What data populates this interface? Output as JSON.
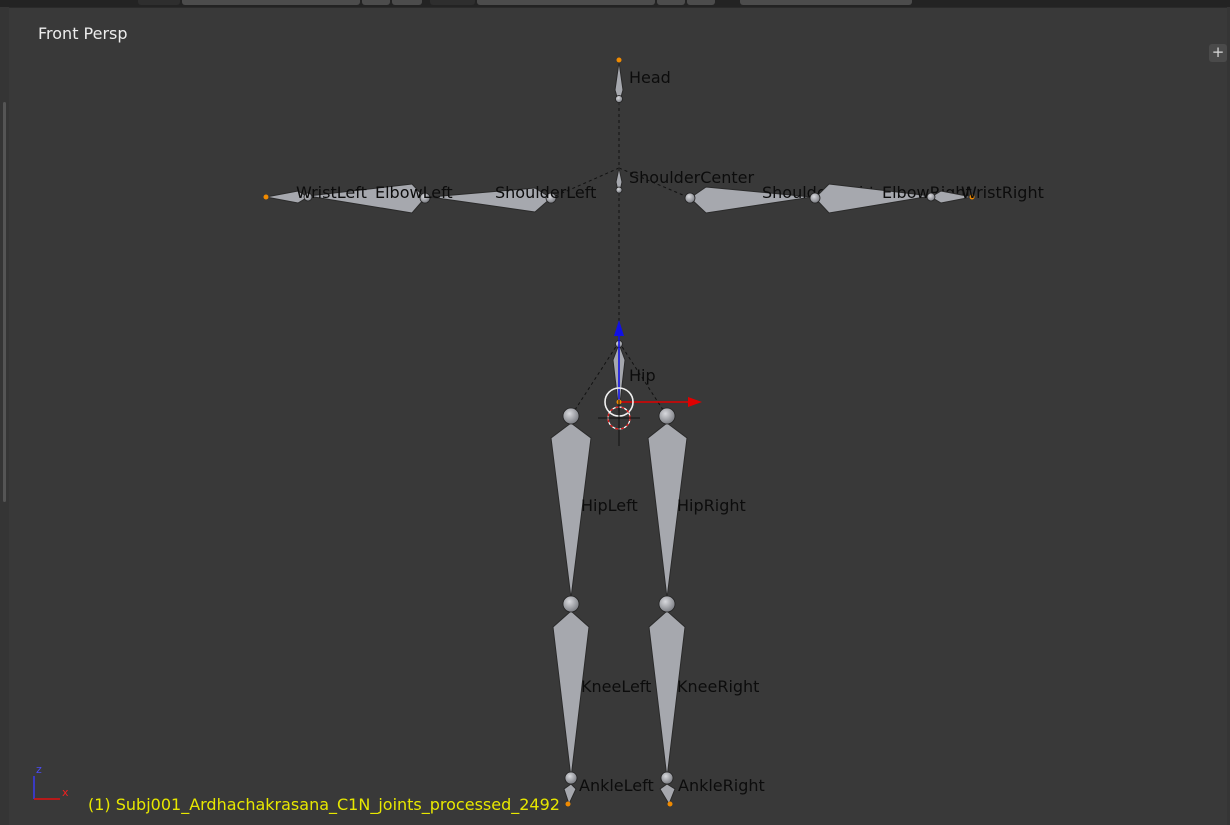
{
  "viewport": {
    "view_label": "Front Persp",
    "status_text": "(1) Subj001_Ardhachakrasana_C1N_joints_processed_2492",
    "add_button": "+"
  },
  "bones": {
    "head": "Head",
    "shoulder_center": "ShoulderCenter",
    "shoulder_left": "ShoulderLeft",
    "elbow_left": "ElbowLeft",
    "wrist_left": "WristLeft",
    "shoulder_right": "ShoulderRight",
    "elbow_right": "ElbowRight",
    "wrist_right": "WristRight",
    "hip": "Hip",
    "hip_left": "HipLeft",
    "hip_right": "HipRight",
    "knee_left": "KneeLeft",
    "knee_right": "KneeRight",
    "ankle_left": "AnkleLeft",
    "ankle_right": "AnkleRight"
  },
  "axes": {
    "z": "z",
    "x": "x"
  },
  "colors": {
    "background": "#393939",
    "bone_fill": "#a6a8ae",
    "bone_stroke": "#2a2a2a",
    "status_text": "#e7e700",
    "view_label": "#ececec",
    "manipulator_x": "#e00000",
    "manipulator_z": "#1010e6",
    "joint_orange": "#f08a00"
  },
  "icons": [
    "plus-icon",
    "3d-cursor-icon",
    "axis-gizmo-icon",
    "move-manipulator-icon"
  ]
}
